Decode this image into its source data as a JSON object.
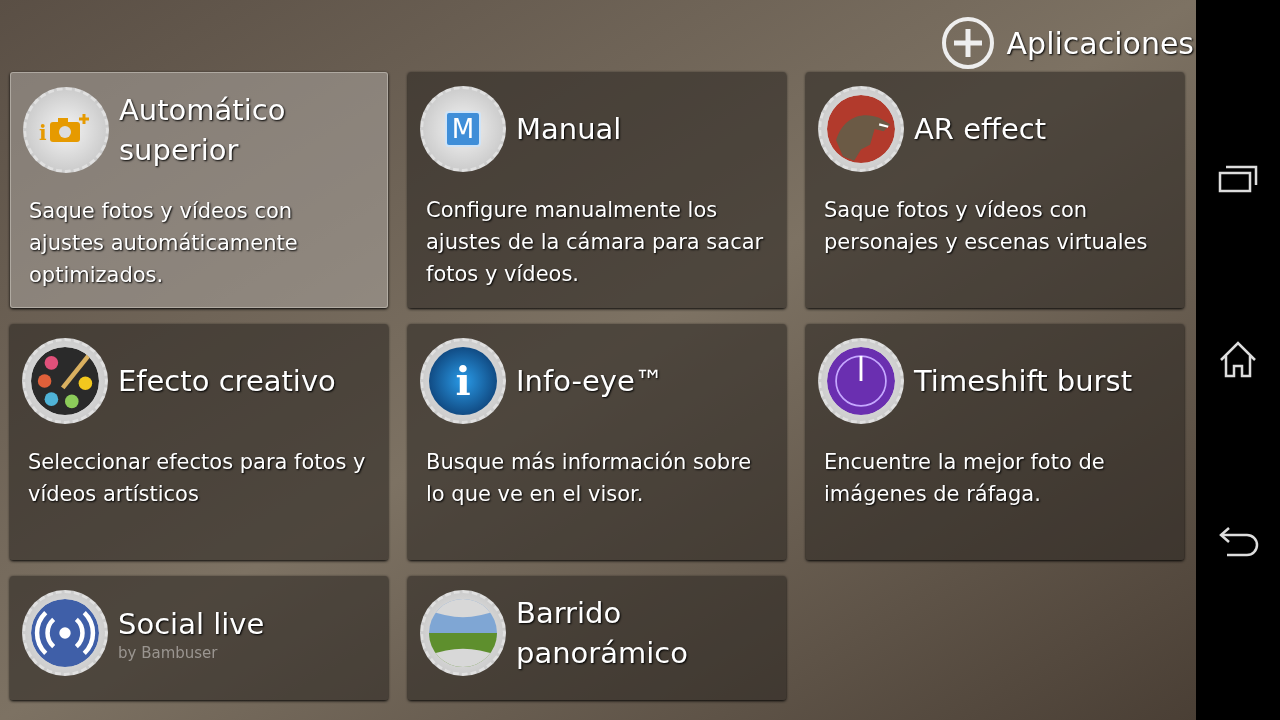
{
  "header": {
    "label": "Aplicaciones"
  },
  "modes": [
    {
      "title": "Automático superior",
      "description": "Saque fotos y vídeos con ajustes automáticamente optimizados.",
      "selected": true,
      "icon": {
        "kind": "camera",
        "label": "i"
      }
    },
    {
      "title": "Manual",
      "description": "Configure manualmente los ajustes de la cámara para sacar fotos y vídeos.",
      "selected": false,
      "icon": {
        "kind": "letter",
        "label": "M"
      }
    },
    {
      "title": "AR effect",
      "description": "Saque fotos y vídeos con personajes y escenas virtuales",
      "selected": false,
      "icon": {
        "kind": "dinosaur"
      }
    },
    {
      "title": "Efecto creativo",
      "description": "Seleccionar efectos para fotos y vídeos artísticos",
      "selected": false,
      "icon": {
        "kind": "palette"
      }
    },
    {
      "title": "Info-eye™",
      "description": "Busque más información sobre lo que ve en el visor.",
      "selected": false,
      "icon": {
        "kind": "info",
        "label": "i"
      }
    },
    {
      "title": "Timeshift burst",
      "description": "Encuentre la mejor foto de imágenes de ráfaga.",
      "selected": false,
      "icon": {
        "kind": "clock"
      }
    },
    {
      "title": "Social live",
      "subtitle": "by Bambuser",
      "selected": false,
      "icon": {
        "kind": "broadcast"
      }
    },
    {
      "title": "Barrido panorámico",
      "selected": false,
      "icon": {
        "kind": "landscape"
      }
    }
  ],
  "nav_bar": {
    "buttons": [
      {
        "kind": "recent"
      },
      {
        "kind": "home"
      },
      {
        "kind": "back"
      }
    ]
  }
}
